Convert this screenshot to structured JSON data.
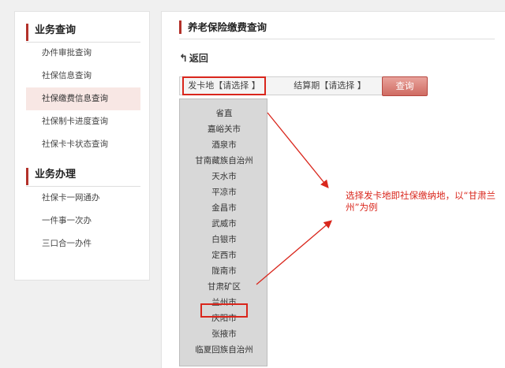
{
  "sidebar": {
    "sections": [
      {
        "title": "业务查询",
        "items": [
          "办件审批查询",
          "社保信息查询",
          "社保缴费信息查询",
          "社保制卡进度查询",
          "社保卡卡状态查询"
        ],
        "active_index": 2
      },
      {
        "title": "业务办理",
        "items": [
          "社保卡一网通办",
          "一件事一次办",
          "三口合一办件"
        ]
      }
    ]
  },
  "main": {
    "title": "养老保险缴费查询",
    "back_label": "返回",
    "card_place_label": "发卡地【请选择 】",
    "period_label": "结算期【请选择 】",
    "query_button": "查询",
    "dropdown_items": [
      "省直",
      "嘉峪关市",
      "酒泉市",
      "甘南藏族自治州",
      "天水市",
      "平凉市",
      "金昌市",
      "武威市",
      "白银市",
      "定西市",
      "陇南市",
      "甘肃矿区",
      "兰州市",
      "庆阳市",
      "张掖市",
      "临夏回族自治州"
    ],
    "selected_item": "兰州市"
  },
  "annotation": {
    "text": "选择发卡地即社保缴纳地，以“甘肃兰州”为例"
  },
  "colors": {
    "accent": "#b3312a",
    "highlight_red": "#d9261c",
    "active_bg": "#f8e7e4"
  }
}
